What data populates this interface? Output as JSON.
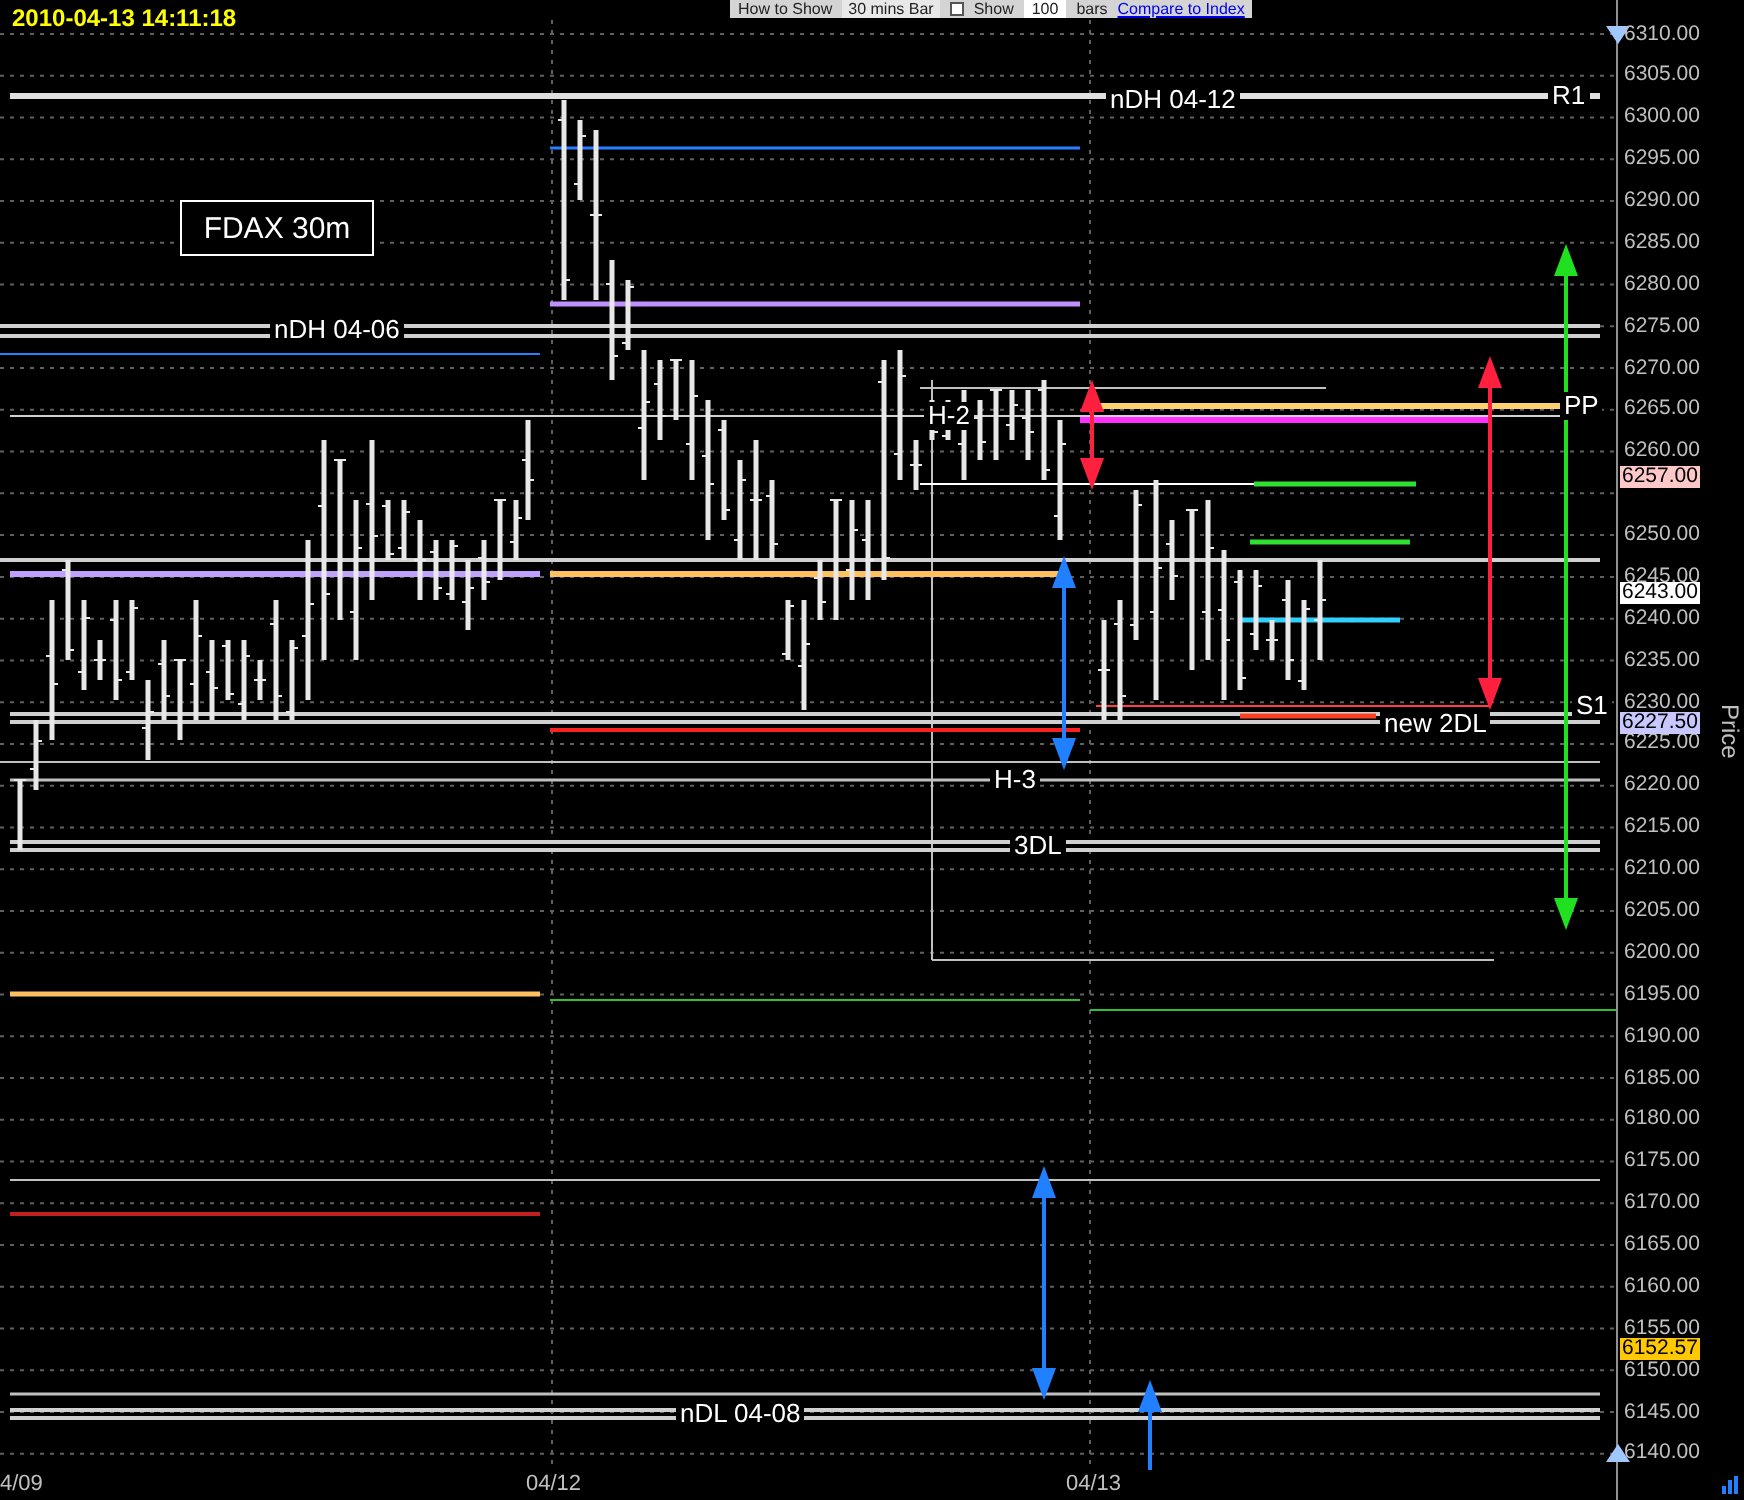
{
  "timestamp": "2010-04-13 14:11:18",
  "toolbar": {
    "how_to_show_label": "How to Show",
    "bar_type": "30 mins Bar",
    "show_checkbox": {
      "label": "Show",
      "checked": false
    },
    "bar_count": "100",
    "bars_label": "bars",
    "compare_link": "Compare to Index"
  },
  "chart": {
    "title": "FDAX 30m",
    "level_labels": [
      {
        "label": "nDH 04-12"
      },
      {
        "label": "R1"
      },
      {
        "label": "nDH 04-06"
      },
      {
        "label": "H-2"
      },
      {
        "label": "PP"
      },
      {
        "label": "S1"
      },
      {
        "label": "new 2DL"
      },
      {
        "label": "H-3"
      },
      {
        "label": "3DL"
      },
      {
        "label": "nDL 04-08"
      }
    ],
    "x_labels": [
      "4/09",
      "04/12",
      "04/13"
    ]
  },
  "price_axis": {
    "title": "Price",
    "ticks": [
      "6310.00",
      "6305.00",
      "6300.00",
      "6295.00",
      "6290.00",
      "6285.00",
      "6280.00",
      "6275.00",
      "6270.00",
      "6265.00",
      "6260.00",
      "6250.00",
      "6245.00",
      "6240.00",
      "6235.00",
      "6230.00",
      "6225.00",
      "6220.00",
      "6215.00",
      "6210.00",
      "6205.00",
      "6200.00",
      "6195.00",
      "6190.00",
      "6185.00",
      "6180.00",
      "6175.00",
      "6170.00",
      "6165.00",
      "6160.00",
      "6155.00",
      "6150.00",
      "6145.00",
      "6140.00"
    ],
    "price_tags": [
      {
        "label": "6257.00",
        "color": "#ffc8c8"
      },
      {
        "label": "6243.00",
        "color": "#ffffff"
      },
      {
        "label": "6227.50",
        "color": "#c8c8ff"
      },
      {
        "label": "6152.57",
        "color": "#ffc800"
      }
    ]
  }
}
